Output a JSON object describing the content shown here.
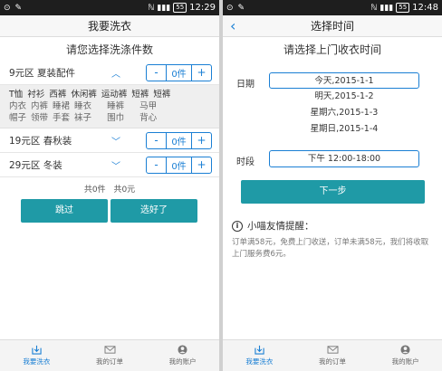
{
  "left": {
    "status": {
      "time": "12:29",
      "battery": "55"
    },
    "title": "我要洗衣",
    "headline": "请您选择洗涤件数",
    "categories": [
      {
        "label": "9元区 夏装配件",
        "count": "0件",
        "expanded": true
      },
      {
        "label": "19元区 春秋装",
        "count": "0件"
      },
      {
        "label": "29元区 冬装",
        "count": "0件"
      }
    ],
    "stepper": {
      "minus": "-",
      "plus": "+"
    },
    "items_grid": [
      [
        "T恤",
        "衬衫",
        "西裤",
        "休闲裤",
        "运动裤",
        "短裤",
        "短裤"
      ],
      [
        "内衣",
        "内裤",
        "睡裙",
        "睡衣",
        "睡裤",
        "马甲"
      ],
      [
        "帽子",
        "领带",
        "手套",
        "袜子",
        "围巾",
        "背心"
      ]
    ],
    "totals": {
      "count": "共0件",
      "price": "共0元"
    },
    "skip_label": "跳过",
    "done_label": "选好了"
  },
  "right": {
    "status": {
      "time": "12:48",
      "battery": "55"
    },
    "title": "选择时间",
    "back_icon": "‹",
    "headline": "请选择上门收衣时间",
    "date_label": "日期",
    "dates": [
      "今天,2015-1-1",
      "明天,2015-1-2",
      "星期六,2015-1-3",
      "星期日,2015-1-4"
    ],
    "period_label": "时段",
    "period_value": "下午 12:00-18:00",
    "next_label": "下一步",
    "tip_icon": "i",
    "tip_title": "小喵友情提醒：",
    "tip_text": "订单满58元，免费上门收送，订单未满58元，我们将收取上门服务费6元。"
  },
  "tabs": [
    {
      "label": "我要洗衣",
      "icon": "washer-icon",
      "active": true
    },
    {
      "label": "我的订单",
      "icon": "mail-icon",
      "active": false
    },
    {
      "label": "我的账户",
      "icon": "user-icon",
      "active": false
    }
  ],
  "status_icons": {
    "left": "android-icon",
    "signal": "signal-icon"
  },
  "accent": "#1a7fd4",
  "button_color": "#1f9aa6"
}
